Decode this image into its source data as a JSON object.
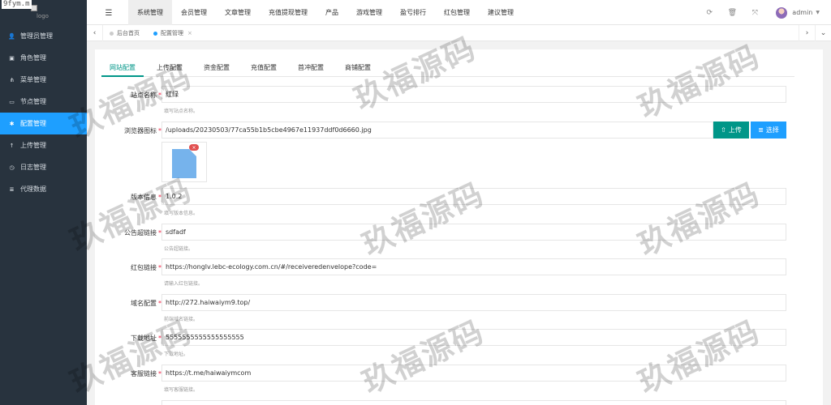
{
  "overlay": {
    "source_watermark": "9fym.m",
    "watermark_text": "玖福源码"
  },
  "logo": {
    "text": "logo"
  },
  "sidebar": {
    "items": [
      {
        "label": "管理员管理",
        "icon": "user-icon"
      },
      {
        "label": "角色管理",
        "icon": "id-card-icon"
      },
      {
        "label": "菜单管理",
        "icon": "hierarchy-icon"
      },
      {
        "label": "节点管理",
        "icon": "folder-icon"
      },
      {
        "label": "配置管理",
        "icon": "gear-icon",
        "active": true
      },
      {
        "label": "上传管理",
        "icon": "upload-arrow-icon"
      },
      {
        "label": "日志管理",
        "icon": "clock-icon"
      },
      {
        "label": "代理数据",
        "icon": "list-icon"
      }
    ]
  },
  "topbar": {
    "menu": [
      "系统管理",
      "会员管理",
      "文章管理",
      "充值提现管理",
      "产品",
      "游戏管理",
      "盈亏排行",
      "红包管理",
      "建议管理"
    ],
    "active_menu": "系统管理",
    "user_name": "admin",
    "icons": [
      "refresh-icon",
      "trash-icon",
      "fullscreen-icon"
    ]
  },
  "tabs": {
    "items": [
      {
        "label": "后台首页"
      },
      {
        "label": "配置管理",
        "active": true,
        "close": "×"
      }
    ]
  },
  "form_tabs": [
    "网站配置",
    "上传配置",
    "资金配置",
    "充值配置",
    "首冲配置",
    "商铺配置"
  ],
  "form": {
    "site_name": {
      "label": "站点名称",
      "value": "红绿",
      "help": "填写站点名称。"
    },
    "favicon": {
      "label": "浏览器图标",
      "value": "/uploads/20230503/77ca55b1b5cbe4967e11937ddf0d6660.jpg",
      "upload_label": "上传",
      "select_label": "选择",
      "preview_close": "×"
    },
    "version": {
      "label": "版本信息",
      "value": "1.0.2",
      "help": "填写版本信息。"
    },
    "notice_link": {
      "label": "公告超链接",
      "value": "sdfadf",
      "help": "公告超链接。"
    },
    "redpacket_link": {
      "label": "红包链接",
      "value": "https://honglv.lebc-ecology.com.cn/#/receiveredenvelope?code=",
      "help": "请输入红包链接。"
    },
    "domain": {
      "label": "域名配置",
      "value": "http://272.haiwaiym9.top/",
      "help": "前端域名链接。"
    },
    "download": {
      "label": "下载地址",
      "value": "5555555555555555555",
      "help": "下载地址。"
    },
    "service_link": {
      "label": "客服链接",
      "value": "https://t.me/haiwaiymcom",
      "help": "填写客服链接。"
    }
  },
  "colors": {
    "sidebar_bg": "#28333e",
    "active_blue": "#1e9fff",
    "teal": "#009688"
  }
}
